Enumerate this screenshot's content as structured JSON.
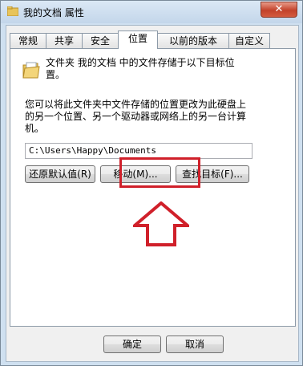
{
  "window": {
    "title": "我的文档 属性",
    "close_glyph": "✕"
  },
  "tabs": [
    {
      "label": "常规"
    },
    {
      "label": "共享"
    },
    {
      "label": "安全"
    },
    {
      "label": "位置"
    },
    {
      "label": "以前的版本"
    },
    {
      "label": "自定义"
    }
  ],
  "location": {
    "description_line1": "文件夹 我的文档 中的文件存储于以下目标位",
    "description_line2": "置。",
    "info_line1": "您可以将此文件夹中文件存储的位置更改为此硬盘上",
    "info_line2": "的另一个位置、另一个驱动器或网络上的另一台计算",
    "info_line3": "机。",
    "path_value": "C:\\Users\\Happy\\Documents",
    "restore_button": "还原默认值(R)",
    "move_button": "移动(M)...",
    "find_button": "查找目标(F)..."
  },
  "dialog": {
    "ok_button": "确定",
    "cancel_button": "取消"
  },
  "annotation": {
    "color": "#d0202a"
  }
}
